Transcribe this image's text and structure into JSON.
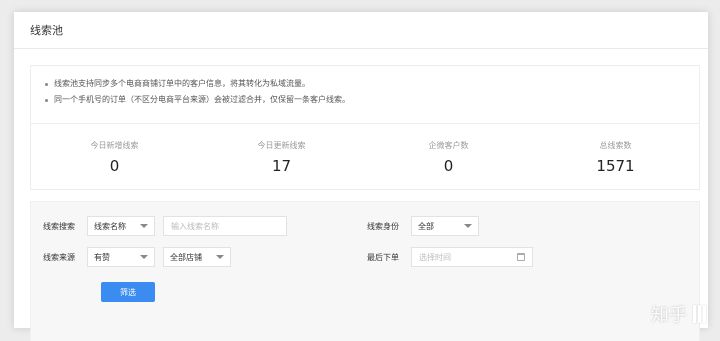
{
  "header": {
    "title": "线索池"
  },
  "notice": {
    "items": [
      "线索池支持同步多个电商商铺订单中的客户信息，将其转化为私域流量。",
      "同一个手机号的订单（不区分电商平台来源）会被过滤合并，仅保留一条客户线索。"
    ]
  },
  "stats": [
    {
      "label": "今日新增线索",
      "value": "0"
    },
    {
      "label": "今日更新线索",
      "value": "17"
    },
    {
      "label": "企微客户数",
      "value": "0"
    },
    {
      "label": "总线索数",
      "value": "1571"
    }
  ],
  "filters": {
    "search": {
      "label": "线索搜索",
      "field_value": "线索名称",
      "placeholder": "输入线索名称"
    },
    "identity": {
      "label": "线索身份",
      "value": "全部"
    },
    "source": {
      "label": "线索来源",
      "value": "有赞",
      "store_value": "全部店铺"
    },
    "last_order": {
      "label": "最后下单",
      "placeholder": "选择时间"
    },
    "submit_label": "筛选"
  },
  "watermark": {
    "text": "知乎"
  }
}
